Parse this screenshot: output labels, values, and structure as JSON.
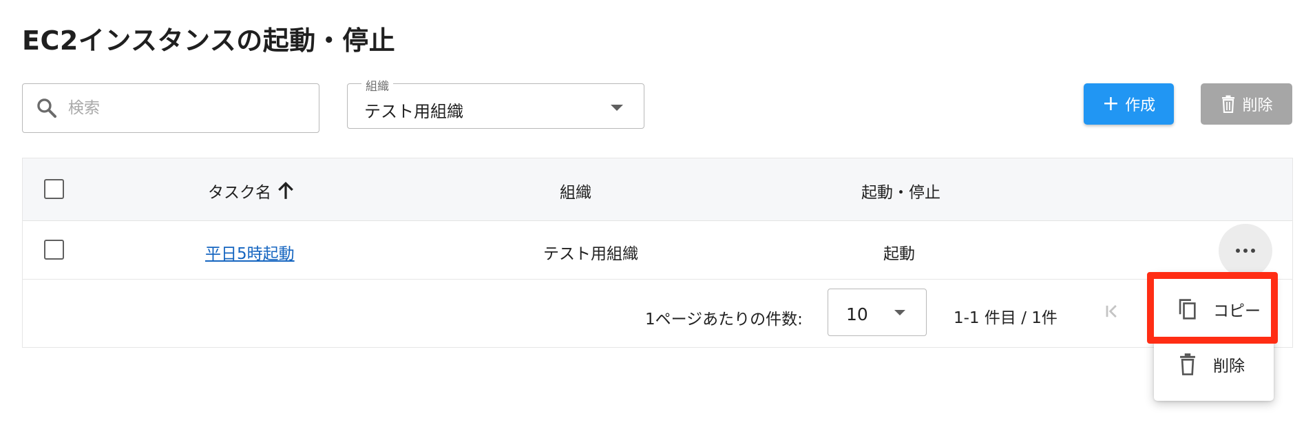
{
  "page": {
    "title": "EC2インスタンスの起動・停止"
  },
  "search": {
    "placeholder": "検索",
    "value": ""
  },
  "org_filter": {
    "label": "組織",
    "value": "テスト用組織"
  },
  "actions": {
    "create_label": "作成",
    "delete_label": "削除"
  },
  "table": {
    "headers": {
      "task_name": "タスク名",
      "org": "組織",
      "start_stop": "起動・停止"
    },
    "sort": {
      "column": "task_name",
      "direction": "ascending"
    },
    "rows": [
      {
        "task_name": "平日5時起動",
        "org": "テスト用組織",
        "start_stop": "起動"
      }
    ]
  },
  "pagination": {
    "per_page_label": "1ページあたりの件数:",
    "per_page_value": "10",
    "range_text": "1-1 件目 / 1件"
  },
  "context_menu": {
    "items": [
      {
        "label": "コピー",
        "icon": "copy-icon"
      },
      {
        "label": "削除",
        "icon": "trash-icon"
      }
    ]
  },
  "colors": {
    "primary": "#2196f3",
    "disabled": "#a6a6a6",
    "link": "#1565c0",
    "highlight": "#ff2d14",
    "header_bg": "#f6f7f9"
  }
}
